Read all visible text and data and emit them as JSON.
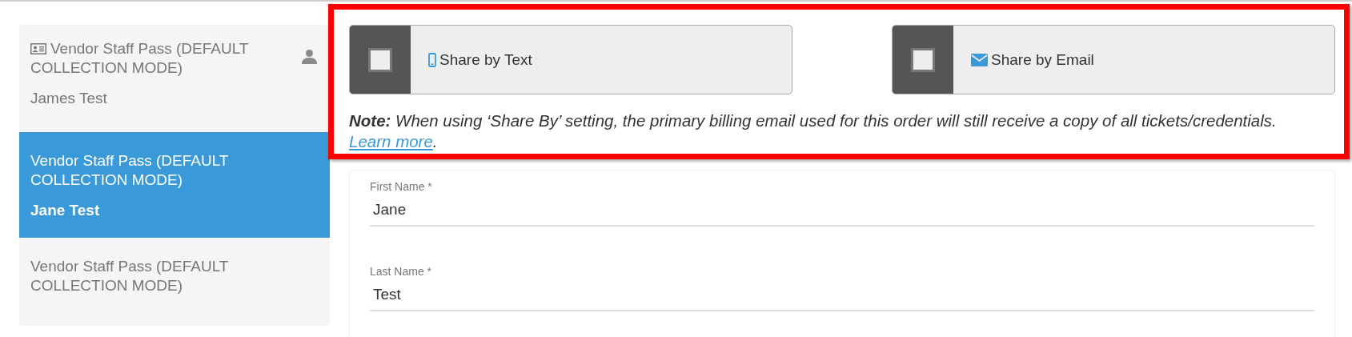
{
  "sidebar": {
    "items": [
      {
        "title": "Vendor Staff Pass (DEFAULT COLLECTION MODE)",
        "name": "James Test",
        "selected": false,
        "show_icons": true
      },
      {
        "title": "Vendor Staff Pass (DEFAULT COLLECTION MODE)",
        "name": "Jane Test",
        "selected": true,
        "show_icons": false
      },
      {
        "title": "Vendor Staff Pass (DEFAULT COLLECTION MODE)",
        "selected": false,
        "show_icons": false
      }
    ]
  },
  "share_options": [
    {
      "kind": "text",
      "label": "Share by Text",
      "checked": false
    },
    {
      "kind": "email",
      "label": "Share by Email",
      "checked": false
    }
  ],
  "note": {
    "text": "**Note:** When using ‘Share By’ setting, the primary billing email used for this order will still receive a copy of all tickets/credentials.",
    "link": "Learn more",
    "trailing": "."
  },
  "form": {
    "fields": [
      {
        "label": "First Name *",
        "value": "Jane"
      },
      {
        "label": "Last Name *",
        "value": "Test"
      }
    ]
  }
}
